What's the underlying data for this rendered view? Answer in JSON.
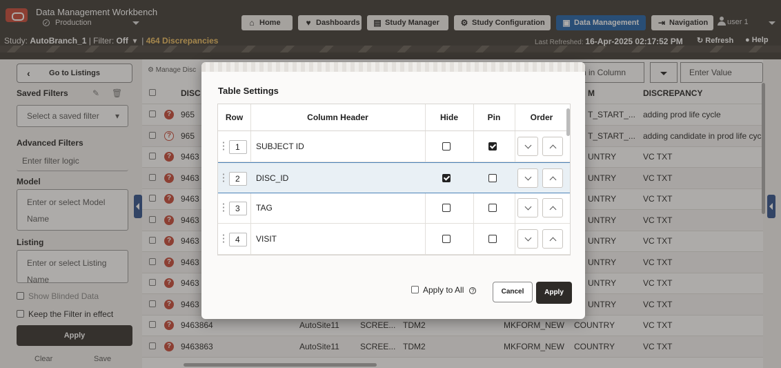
{
  "header": {
    "app_title": "Data Management Workbench",
    "environment": "Production",
    "nav": [
      {
        "label": "Home",
        "icon": "home-icon"
      },
      {
        "label": "Dashboards",
        "icon": "heart-pulse-icon"
      },
      {
        "label": "Study Manager",
        "icon": "clipboard-icon"
      },
      {
        "label": "Study Configuration",
        "icon": "gear-icon"
      },
      {
        "label": "Data Management",
        "icon": "data-management-icon"
      },
      {
        "label": "Navigation",
        "icon": "navigation-icon"
      }
    ],
    "user": "user 1",
    "study_label": "Study:",
    "study_name": "AutoBranch_1",
    "filter_label": "| Filter:",
    "filter_value": "Off",
    "discrepancies": "464 Discrepancies",
    "last_refreshed_label": "Last Refreshed:",
    "last_refreshed_value": "16-Apr-2025 02:17:52 PM",
    "refresh_label": "Refresh",
    "help_label": "Help"
  },
  "left_panel": {
    "go_to_listings": "Go to Listings",
    "saved_filters_title": "Saved Filters",
    "saved_filter_placeholder": "Select a saved filter",
    "advanced_filters_title": "Advanced Filters",
    "filter_logic_placeholder": "Enter filter logic",
    "model_title": "Model",
    "model_placeholder_1": "Enter or select Model",
    "model_placeholder_2": "Name",
    "listing_title": "Listing",
    "listing_placeholder_1": "Enter or select Listing",
    "listing_placeholder_2": "Name",
    "show_blinded": "Show Blinded Data",
    "keep_filter": "Keep the Filter in effect",
    "apply": "Apply",
    "clear": "Clear",
    "save": "Save"
  },
  "main": {
    "manage_label": "Manage Disc",
    "search_in_column": "rch in Column",
    "enter_value": "Enter Value",
    "headers": {
      "disc": "DISC",
      "m": "M",
      "discrepancy": "DISCREPANCY"
    },
    "rows": [
      {
        "id": "965",
        "icon": "filled",
        "m": "T_START_...",
        "discrepancy": "adding prod life cycle"
      },
      {
        "id": "965",
        "icon": "outline",
        "m": "T_START_...",
        "discrepancy": "adding candidate in prod life cyc"
      },
      {
        "id": "9463",
        "icon": "filled",
        "m": "UNTRY",
        "discrepancy": "VC TXT"
      },
      {
        "id": "9463",
        "icon": "filled",
        "m": "UNTRY",
        "discrepancy": "VC TXT"
      },
      {
        "id": "9463",
        "icon": "filled",
        "m": "UNTRY",
        "discrepancy": "VC TXT"
      },
      {
        "id": "9463",
        "icon": "filled",
        "m": "UNTRY",
        "discrepancy": "VC TXT"
      },
      {
        "id": "9463",
        "icon": "filled",
        "m": "UNTRY",
        "discrepancy": "VC TXT"
      },
      {
        "id": "9463",
        "icon": "filled",
        "m": "UNTRY",
        "discrepancy": "VC TXT"
      },
      {
        "id": "9463",
        "icon": "filled",
        "m": "UNTRY",
        "discrepancy": "VC TXT"
      },
      {
        "id": "9463",
        "icon": "filled",
        "m": "UNTRY",
        "discrepancy": "VC TXT"
      },
      {
        "id": "9463864",
        "icon": "filled",
        "site": "AutoSite11",
        "visit": "SCREE...",
        "tdm": "TDM2",
        "form": "MKFORM_NEW",
        "m": "COUNTRY",
        "discrepancy": "VC TXT"
      },
      {
        "id": "9463863",
        "icon": "filled",
        "site": "AutoSite11",
        "visit": "SCREE...",
        "tdm": "TDM2",
        "form": "MKFORM_NEW",
        "m": "COUNTRY",
        "discrepancy": "VC TXT"
      }
    ]
  },
  "dialog": {
    "title": "Table Settings",
    "columns": {
      "row": "Row",
      "header": "Column Header",
      "hide": "Hide",
      "pin": "Pin",
      "order": "Order"
    },
    "rows": [
      {
        "num": "1",
        "name": "SUBJECT ID",
        "hide": false,
        "pin": true,
        "selected": false
      },
      {
        "num": "2",
        "name": "DISC_ID",
        "hide": true,
        "pin": false,
        "selected": true
      },
      {
        "num": "3",
        "name": "TAG",
        "hide": false,
        "pin": false,
        "selected": false
      },
      {
        "num": "4",
        "name": "VISIT",
        "hide": false,
        "pin": false,
        "selected": false
      }
    ],
    "apply_to_all": "Apply to All",
    "cancel": "Cancel",
    "apply": "Apply"
  }
}
